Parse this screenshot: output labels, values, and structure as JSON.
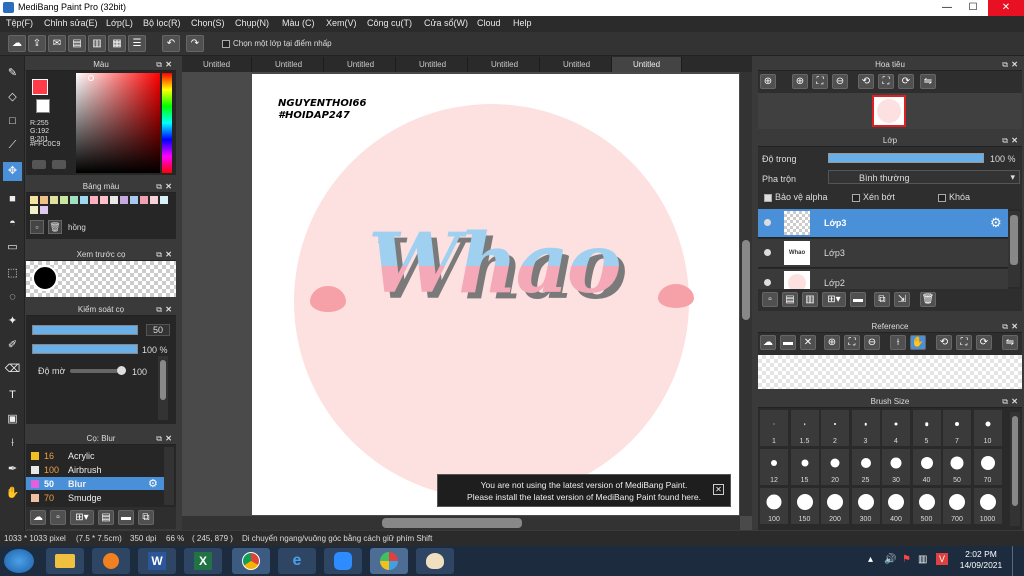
{
  "window": {
    "title": "MediBang Paint Pro (32bit)",
    "min": "—",
    "max": "☐",
    "close": "✕"
  },
  "menu": [
    "Tệp(F)",
    "Chỉnh sửa(E)",
    "Lớp(L)",
    "Bộ lọc(R)",
    "Chọn(S)",
    "Chụp(N)",
    "Màu (C)",
    "Xem(V)",
    "Công cụ(T)",
    "Cửa sổ(W)",
    "Cloud",
    "Help"
  ],
  "toolbar": {
    "checkbox_label": "Chọn một lớp tại điểm nhấp"
  },
  "color_panel": {
    "title": "Màu",
    "r": "R:255",
    "g": "G:192",
    "b": "B:201",
    "hex": "#FFC0C9",
    "main_color": "#FF3B4A",
    "sub_color": "#FFFFFF"
  },
  "palette_panel": {
    "title": "Bảng màu",
    "name": "hồng",
    "colors": [
      "#f7e3a0",
      "#f0c08a",
      "#e0e0a0",
      "#c8e6a0",
      "#a0e0c0",
      "#9fd8f0",
      "#ffb0c0",
      "#ffc0c9",
      "#e8e8e8",
      "#c8a8e0",
      "#a8c8f0",
      "#f0a0b0",
      "#f8d0d8",
      "#d8f0f8",
      "#f0f0c8",
      "#e0c8f0"
    ]
  },
  "brush_preview": {
    "title": "Xem trước cọ"
  },
  "brush_control": {
    "title": "Kiểm soát cọ",
    "size": "50",
    "opacity": "100 %",
    "blur_label": "Độ mờ",
    "blur_value": "100"
  },
  "brush_list": {
    "title": "Cọ: Blur",
    "items": [
      {
        "size": "16",
        "name": "Acrylic",
        "color": "#f0c020"
      },
      {
        "size": "100",
        "name": "Airbrush",
        "color": "#e8e8e8"
      },
      {
        "size": "50",
        "name": "Blur",
        "color": "#e060e0"
      },
      {
        "size": "70",
        "name": "Smudge",
        "color": "#f0c0a0"
      }
    ]
  },
  "tabs": [
    "Untitled",
    "Untitled",
    "Untitled",
    "Untitled",
    "Untitled",
    "Untitled",
    "Untitled"
  ],
  "artwork": {
    "author": "NGUYENTHOI66",
    "hashtag": "#HOIDAP247",
    "word": "Whao"
  },
  "notice": {
    "line1": "You are not using the latest version of MediBang Paint.",
    "line2": "Please install the latest version of MediBang Paint found here.",
    "close": "✕"
  },
  "navigator": {
    "title": "Hoa tiêu"
  },
  "layers": {
    "title": "Lớp",
    "opacity_label": "Độ trong",
    "opacity_value": "100 %",
    "blend_label": "Pha trộn",
    "blend_value": "Bình thường",
    "protect_alpha": "Bảo vệ alpha",
    "clipping": "Xén bớt",
    "lock": "Khóa",
    "items": [
      {
        "name": "Lớp3",
        "thumb": "Whao"
      },
      {
        "name": "Lớp3",
        "thumb": "Whao"
      },
      {
        "name": "Lớp2",
        "thumb": ""
      }
    ]
  },
  "reference": {
    "title": "Reference"
  },
  "brush_size": {
    "title": "Brush Size",
    "sizes": [
      "1",
      "1.5",
      "2",
      "3",
      "4",
      "5",
      "7",
      "10",
      "12",
      "15",
      "20",
      "25",
      "30",
      "40",
      "50",
      "70",
      "100",
      "150",
      "200",
      "300",
      "400",
      "500",
      "700",
      "1000"
    ]
  },
  "status": {
    "dims": "1033 * 1033 pixel",
    "size": "(7.5 * 7.5cm)",
    "dpi": "350 dpi",
    "zoom": "66 %",
    "coords": "( 245, 879 )",
    "hint": "Di chuyển ngang/vuông góc bằng cách giữ phím Shift"
  },
  "clock": {
    "time": "2:02 PM",
    "date": "14/09/2021"
  }
}
